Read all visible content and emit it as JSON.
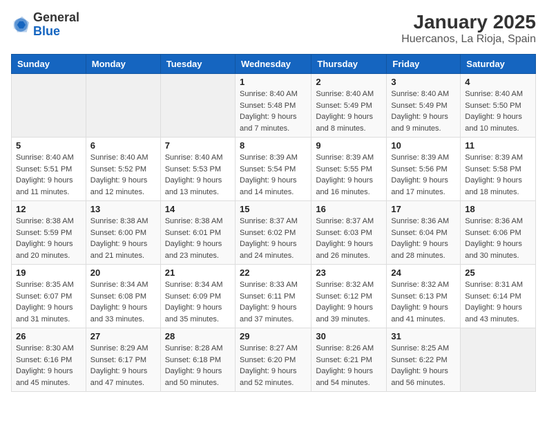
{
  "app": {
    "name_general": "General",
    "name_blue": "Blue"
  },
  "title": "January 2025",
  "subtitle": "Huercanos, La Rioja, Spain",
  "weekdays": [
    "Sunday",
    "Monday",
    "Tuesday",
    "Wednesday",
    "Thursday",
    "Friday",
    "Saturday"
  ],
  "weeks": [
    [
      {
        "day": "",
        "info": ""
      },
      {
        "day": "",
        "info": ""
      },
      {
        "day": "",
        "info": ""
      },
      {
        "day": "1",
        "info": "Sunrise: 8:40 AM\nSunset: 5:48 PM\nDaylight: 9 hours\nand 7 minutes."
      },
      {
        "day": "2",
        "info": "Sunrise: 8:40 AM\nSunset: 5:49 PM\nDaylight: 9 hours\nand 8 minutes."
      },
      {
        "day": "3",
        "info": "Sunrise: 8:40 AM\nSunset: 5:49 PM\nDaylight: 9 hours\nand 9 minutes."
      },
      {
        "day": "4",
        "info": "Sunrise: 8:40 AM\nSunset: 5:50 PM\nDaylight: 9 hours\nand 10 minutes."
      }
    ],
    [
      {
        "day": "5",
        "info": "Sunrise: 8:40 AM\nSunset: 5:51 PM\nDaylight: 9 hours\nand 11 minutes."
      },
      {
        "day": "6",
        "info": "Sunrise: 8:40 AM\nSunset: 5:52 PM\nDaylight: 9 hours\nand 12 minutes."
      },
      {
        "day": "7",
        "info": "Sunrise: 8:40 AM\nSunset: 5:53 PM\nDaylight: 9 hours\nand 13 minutes."
      },
      {
        "day": "8",
        "info": "Sunrise: 8:39 AM\nSunset: 5:54 PM\nDaylight: 9 hours\nand 14 minutes."
      },
      {
        "day": "9",
        "info": "Sunrise: 8:39 AM\nSunset: 5:55 PM\nDaylight: 9 hours\nand 16 minutes."
      },
      {
        "day": "10",
        "info": "Sunrise: 8:39 AM\nSunset: 5:56 PM\nDaylight: 9 hours\nand 17 minutes."
      },
      {
        "day": "11",
        "info": "Sunrise: 8:39 AM\nSunset: 5:58 PM\nDaylight: 9 hours\nand 18 minutes."
      }
    ],
    [
      {
        "day": "12",
        "info": "Sunrise: 8:38 AM\nSunset: 5:59 PM\nDaylight: 9 hours\nand 20 minutes."
      },
      {
        "day": "13",
        "info": "Sunrise: 8:38 AM\nSunset: 6:00 PM\nDaylight: 9 hours\nand 21 minutes."
      },
      {
        "day": "14",
        "info": "Sunrise: 8:38 AM\nSunset: 6:01 PM\nDaylight: 9 hours\nand 23 minutes."
      },
      {
        "day": "15",
        "info": "Sunrise: 8:37 AM\nSunset: 6:02 PM\nDaylight: 9 hours\nand 24 minutes."
      },
      {
        "day": "16",
        "info": "Sunrise: 8:37 AM\nSunset: 6:03 PM\nDaylight: 9 hours\nand 26 minutes."
      },
      {
        "day": "17",
        "info": "Sunrise: 8:36 AM\nSunset: 6:04 PM\nDaylight: 9 hours\nand 28 minutes."
      },
      {
        "day": "18",
        "info": "Sunrise: 8:36 AM\nSunset: 6:06 PM\nDaylight: 9 hours\nand 30 minutes."
      }
    ],
    [
      {
        "day": "19",
        "info": "Sunrise: 8:35 AM\nSunset: 6:07 PM\nDaylight: 9 hours\nand 31 minutes."
      },
      {
        "day": "20",
        "info": "Sunrise: 8:34 AM\nSunset: 6:08 PM\nDaylight: 9 hours\nand 33 minutes."
      },
      {
        "day": "21",
        "info": "Sunrise: 8:34 AM\nSunset: 6:09 PM\nDaylight: 9 hours\nand 35 minutes."
      },
      {
        "day": "22",
        "info": "Sunrise: 8:33 AM\nSunset: 6:11 PM\nDaylight: 9 hours\nand 37 minutes."
      },
      {
        "day": "23",
        "info": "Sunrise: 8:32 AM\nSunset: 6:12 PM\nDaylight: 9 hours\nand 39 minutes."
      },
      {
        "day": "24",
        "info": "Sunrise: 8:32 AM\nSunset: 6:13 PM\nDaylight: 9 hours\nand 41 minutes."
      },
      {
        "day": "25",
        "info": "Sunrise: 8:31 AM\nSunset: 6:14 PM\nDaylight: 9 hours\nand 43 minutes."
      }
    ],
    [
      {
        "day": "26",
        "info": "Sunrise: 8:30 AM\nSunset: 6:16 PM\nDaylight: 9 hours\nand 45 minutes."
      },
      {
        "day": "27",
        "info": "Sunrise: 8:29 AM\nSunset: 6:17 PM\nDaylight: 9 hours\nand 47 minutes."
      },
      {
        "day": "28",
        "info": "Sunrise: 8:28 AM\nSunset: 6:18 PM\nDaylight: 9 hours\nand 50 minutes."
      },
      {
        "day": "29",
        "info": "Sunrise: 8:27 AM\nSunset: 6:20 PM\nDaylight: 9 hours\nand 52 minutes."
      },
      {
        "day": "30",
        "info": "Sunrise: 8:26 AM\nSunset: 6:21 PM\nDaylight: 9 hours\nand 54 minutes."
      },
      {
        "day": "31",
        "info": "Sunrise: 8:25 AM\nSunset: 6:22 PM\nDaylight: 9 hours\nand 56 minutes."
      },
      {
        "day": "",
        "info": ""
      }
    ]
  ]
}
